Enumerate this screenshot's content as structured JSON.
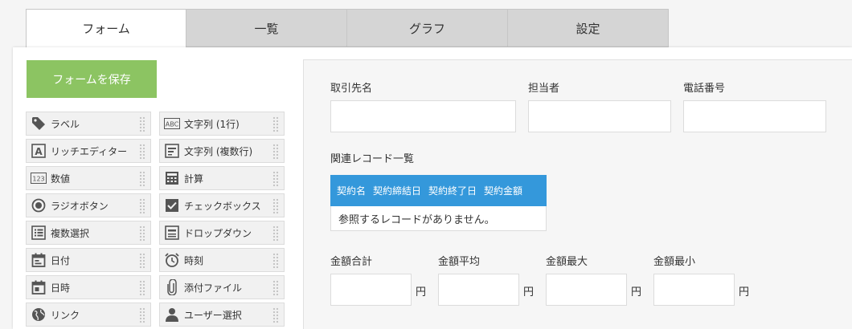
{
  "tabs": [
    {
      "label": "フォーム",
      "active": true
    },
    {
      "label": "一覧",
      "active": false
    },
    {
      "label": "グラフ",
      "active": false
    },
    {
      "label": "設定",
      "active": false
    }
  ],
  "save_button": "フォームを保存",
  "palette": [
    {
      "label": "ラベル",
      "icon": "tag-icon"
    },
    {
      "label": "文字列 (1行)",
      "icon": "abc-text-icon"
    },
    {
      "label": "リッチエディター",
      "icon": "rich-text-icon"
    },
    {
      "label": "文字列 (複数行)",
      "icon": "multiline-text-icon"
    },
    {
      "label": "数値",
      "icon": "number-icon"
    },
    {
      "label": "計算",
      "icon": "calculator-icon"
    },
    {
      "label": "ラジオボタン",
      "icon": "radio-button-icon"
    },
    {
      "label": "チェックボックス",
      "icon": "checkbox-icon"
    },
    {
      "label": "複数選択",
      "icon": "multi-select-icon"
    },
    {
      "label": "ドロップダウン",
      "icon": "dropdown-icon"
    },
    {
      "label": "日付",
      "icon": "date-icon"
    },
    {
      "label": "時刻",
      "icon": "clock-icon"
    },
    {
      "label": "日時",
      "icon": "datetime-icon"
    },
    {
      "label": "添付ファイル",
      "icon": "paperclip-icon"
    },
    {
      "label": "リンク",
      "icon": "globe-icon"
    },
    {
      "label": "ユーザー選択",
      "icon": "user-icon"
    }
  ],
  "form": {
    "client_label": "取引先名",
    "person_label": "担当者",
    "phone_label": "電話番号",
    "related_label": "関連レコード一覧",
    "table_headers": [
      "契約名",
      "契約締結日",
      "契約終了日",
      "契約金額"
    ],
    "table_empty": "参照するレコードがありません。",
    "sum_label": "金額合計",
    "avg_label": "金額平均",
    "max_label": "金額最大",
    "min_label": "金額最小",
    "unit": "円"
  },
  "colors": {
    "accent_green": "#8cc462",
    "table_blue": "#3498db"
  }
}
